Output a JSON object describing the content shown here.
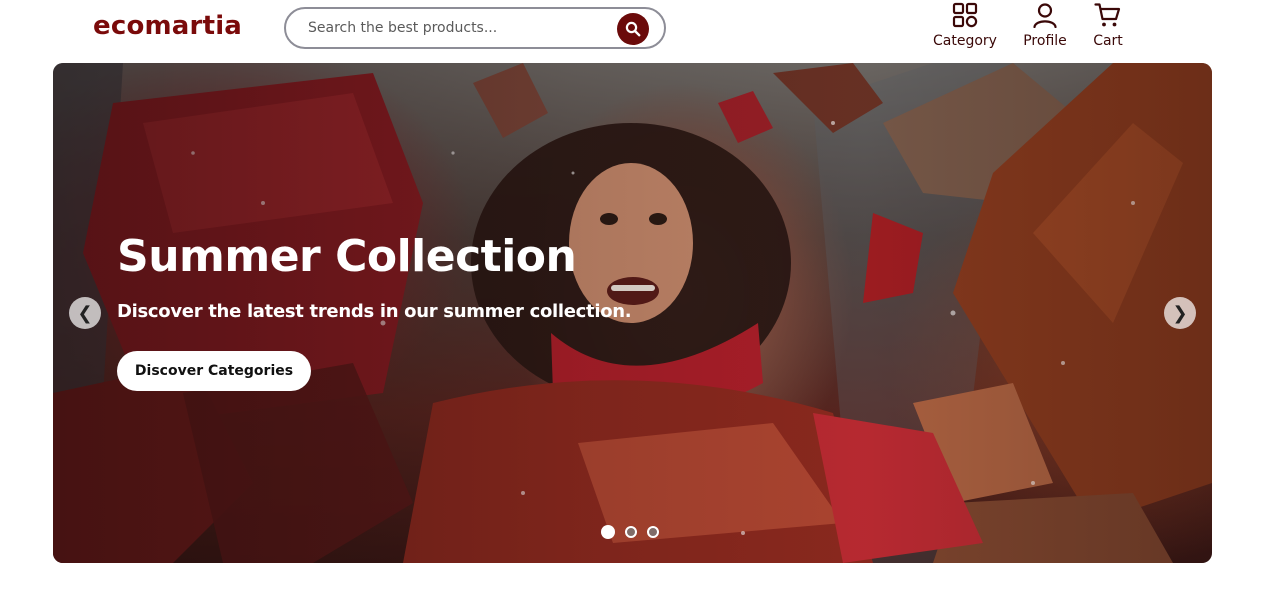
{
  "header": {
    "logo": "ecomartia",
    "search": {
      "placeholder": "Search the best products..."
    },
    "nav": [
      {
        "label": "Category",
        "icon": "grid-icon"
      },
      {
        "label": "Profile",
        "icon": "user-icon"
      },
      {
        "label": "Cart",
        "icon": "cart-icon"
      }
    ]
  },
  "hero": {
    "title": "Summer Collection",
    "subtitle": "Discover the latest trends in our summer collection.",
    "cta_label": "Discover Categories",
    "prev_icon": "❮",
    "next_icon": "❯",
    "slides_total": 3,
    "active_slide": 1
  },
  "colors": {
    "brand": "#7a0a0a",
    "search_button": "#6b0a0a",
    "nav_text": "#3a0808"
  }
}
